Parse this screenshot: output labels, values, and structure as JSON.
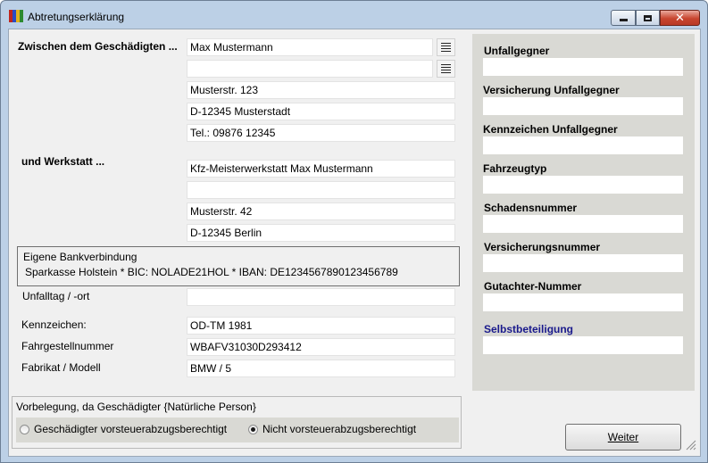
{
  "window": {
    "title": "Abtretungserklärung",
    "accent_close": "#c8452f"
  },
  "parties": {
    "injured_label": "Zwischen dem Geschädigten ...",
    "injured_name": "Max Mustermann",
    "injured_name2": "",
    "injured_street": "Musterstr. 123",
    "injured_city": "D-12345 Musterstadt",
    "injured_phone": "Tel.: 09876 12345",
    "workshop_label": "und Werkstatt ...",
    "workshop_name": "Kfz-Meisterwerkstatt Max Mustermann",
    "workshop_name2": "",
    "workshop_street": "Musterstr. 42",
    "workshop_city": "D-12345 Berlin"
  },
  "bank": {
    "title": "Eigene Bankverbindung",
    "value": "Sparkasse Holstein * BIC: NOLADE21HOL * IBAN: DE1234567890123456789"
  },
  "accident": {
    "date_place_label": "Unfalltag / -ort",
    "date_place_value": "",
    "plate_label": "Kennzeichen:",
    "plate_value": "OD-TM 1981",
    "vin_label": "Fahrgestellnummer",
    "vin_value": "WBAFV31030D293412",
    "make_label": "Fabrikat / Modell",
    "make_value": "BMW / 5"
  },
  "side": {
    "opponent_label": "Unfallgegner",
    "opponent_value": "",
    "opponent_insurance_label": "Versicherung Unfallgegner",
    "opponent_insurance_value": "",
    "opponent_plate_label": "Kennzeichen Unfallgegner",
    "opponent_plate_value": "",
    "vehicle_type_label": "Fahrzeugtyp",
    "vehicle_type_value": "",
    "claim_no_label": "Schadensnummer",
    "claim_no_value": "",
    "policy_no_label": "Versicherungsnummer",
    "policy_no_value": "",
    "expert_no_label": "Gutachter-Nummer",
    "expert_no_value": "",
    "deductible_label": "Selbstbeteiligung",
    "deductible_value": "",
    "deductible_color": "#1a1a8c"
  },
  "vat": {
    "group_label": "Vorbelegung, da Geschädigter {Natürliche Person}",
    "option_entitled": "Geschädigter vorsteuerabzugsberechtigt",
    "option_not_entitled": "Nicht vorsteuerabzugsberechtigt",
    "selected": "option_not_entitled"
  },
  "actions": {
    "next_label": "Weiter"
  },
  "icons": {
    "app": "app-books-icon",
    "list": "list-icon",
    "minimize": "minimize-icon",
    "maximize": "maximize-icon",
    "close": "close-icon",
    "grip": "resize-grip-icon"
  }
}
